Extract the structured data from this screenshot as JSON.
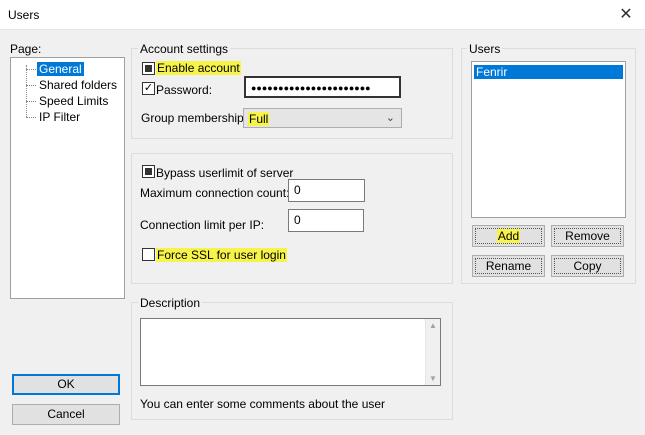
{
  "window": {
    "title": "Users",
    "close_glyph": "✕"
  },
  "page": {
    "label": "Page:",
    "items": [
      {
        "label": "General",
        "selected": true
      },
      {
        "label": "Shared folders",
        "selected": false
      },
      {
        "label": "Speed Limits",
        "selected": false
      },
      {
        "label": "IP Filter",
        "selected": false
      }
    ]
  },
  "account_settings": {
    "legend": "Account settings",
    "enable_account": {
      "label": "Enable account",
      "state": "indeterminate"
    },
    "password": {
      "label": "Password:",
      "checked": true,
      "value": "●●●●●●●●●●●●●●●●●●●●●●"
    },
    "group_membership": {
      "label": "Group membership:",
      "value": "Full"
    }
  },
  "limits": {
    "bypass": {
      "label": "Bypass userlimit of server",
      "state": "indeterminate"
    },
    "max_connection": {
      "label": "Maximum connection count:",
      "value": "0"
    },
    "limit_per_ip": {
      "label": "Connection limit per IP:",
      "value": "0"
    },
    "force_ssl": {
      "label": "Force SSL for user login",
      "checked": false
    }
  },
  "description": {
    "legend": "Description",
    "value": "",
    "hint": "You can enter some comments about the user"
  },
  "users": {
    "legend": "Users",
    "list": [
      "Fenrir"
    ],
    "add_label": "Add",
    "remove_label": "Remove",
    "rename_label": "Rename",
    "copy_label": "Copy"
  },
  "footer": {
    "ok_label": "OK",
    "cancel_label": "Cancel"
  },
  "colors": {
    "highlight": "#f6f34a",
    "selection": "#0078d7",
    "dialog_bg": "#f0f0f0"
  }
}
